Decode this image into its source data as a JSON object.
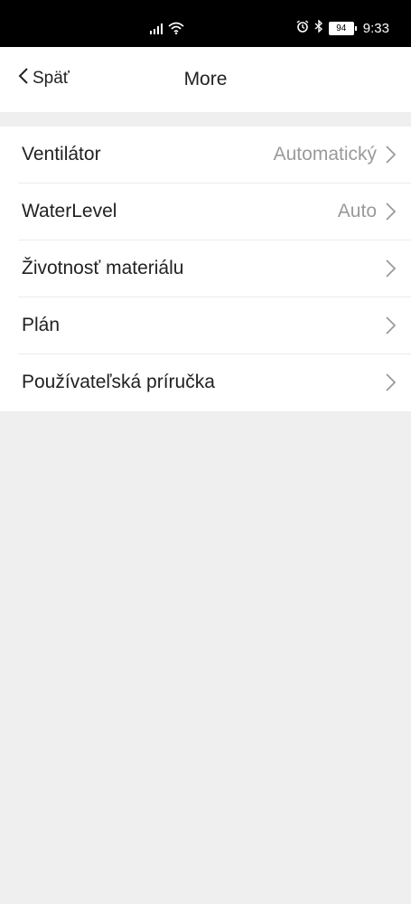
{
  "status_bar": {
    "battery": "94",
    "time": "9:33"
  },
  "header": {
    "back_label": "Späť",
    "title": "More"
  },
  "settings": {
    "items": [
      {
        "label": "Ventilátor",
        "value": "Automatický"
      },
      {
        "label": "WaterLevel",
        "value": "Auto"
      },
      {
        "label": "Životnosť materiálu",
        "value": ""
      },
      {
        "label": "Plán",
        "value": ""
      },
      {
        "label": "Používateľská príručka",
        "value": ""
      }
    ]
  },
  "icons": {
    "back": "chevron-left-icon",
    "row_chevron": "chevron-right-icon",
    "signal": "signal-icon",
    "wifi": "wifi-icon",
    "alarm": "alarm-icon",
    "bluetooth": "bluetooth-icon"
  },
  "colors": {
    "status_bar_bg": "#000000",
    "page_bg": "#efefef",
    "surface": "#ffffff",
    "text_primary": "#222222",
    "text_secondary": "#9a9a9a"
  }
}
